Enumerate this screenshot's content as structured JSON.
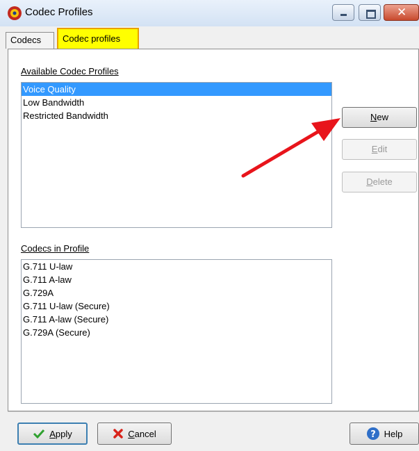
{
  "window": {
    "title": "Codec Profiles",
    "close_glyph": "✕"
  },
  "tabs": [
    {
      "label": "Codecs",
      "active": false
    },
    {
      "label": "Codec profiles",
      "active": true,
      "highlight_color": "#ffff00"
    }
  ],
  "profiles": {
    "label": "Available Codec Profiles",
    "items": [
      "Voice Quality",
      "Low Bandwidth",
      "Restricted Bandwidth"
    ],
    "selected_index": 0
  },
  "codecs": {
    "label": "Codecs in Profile",
    "items": [
      "G.711 U-law",
      "G.711 A-law",
      "G.729A",
      "G.711 U-law (Secure)",
      "G.711 A-law (Secure)",
      "G.729A (Secure)"
    ]
  },
  "side_buttons": {
    "new": {
      "mnemonic": "N",
      "rest": "ew",
      "enabled": true
    },
    "edit": {
      "mnemonic": "E",
      "rest": "dit",
      "enabled": false
    },
    "delete": {
      "mnemonic": "D",
      "rest": "elete",
      "enabled": false
    }
  },
  "footer": {
    "apply": {
      "mnemonic": "A",
      "rest": "pply",
      "icon": "checkmark-icon"
    },
    "cancel": {
      "mnemonic": "C",
      "rest": "ancel",
      "icon": "red-x-icon"
    },
    "help": {
      "label": "Help",
      "icon": "help-icon"
    }
  },
  "annotation": {
    "color": "#e8141b",
    "icon": "red-arrow-annotation"
  }
}
